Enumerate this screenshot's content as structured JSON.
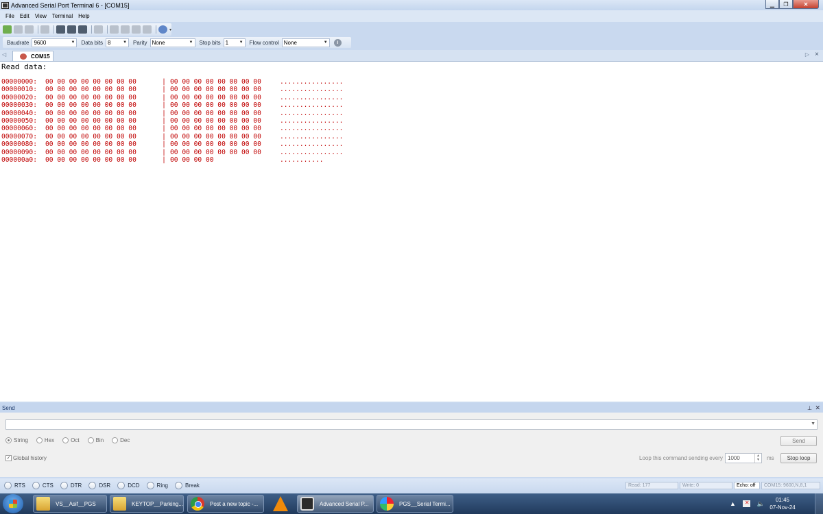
{
  "window": {
    "title": "Advanced Serial Port Terminal 6 - [COM15]"
  },
  "menu": [
    "File",
    "Edit",
    "View",
    "Terminal",
    "Help"
  ],
  "settings": {
    "baudrate_label": "Baudrate",
    "baudrate": "9600",
    "databits_label": "Data bits",
    "databits": "8",
    "parity_label": "Parity",
    "parity": "None",
    "stopbits_label": "Stop bits",
    "stopbits": "1",
    "flow_label": "Flow control",
    "flow": "None"
  },
  "tab": {
    "label": "COM15"
  },
  "terminal": {
    "header": "Read data:",
    "rows": [
      {
        "addr": "00000000:",
        "hex1": "00 00 00 00 00 00 00 00",
        "sep": "|",
        "hex2": "00 00 00 00 00 00 00 00",
        "ascii": "................"
      },
      {
        "addr": "00000010:",
        "hex1": "00 00 00 00 00 00 00 00",
        "sep": "|",
        "hex2": "00 00 00 00 00 00 00 00",
        "ascii": "................"
      },
      {
        "addr": "00000020:",
        "hex1": "00 00 00 00 00 00 00 00",
        "sep": "|",
        "hex2": "00 00 00 00 00 00 00 00",
        "ascii": "................"
      },
      {
        "addr": "00000030:",
        "hex1": "00 00 00 00 00 00 00 00",
        "sep": "|",
        "hex2": "00 00 00 00 00 00 00 00",
        "ascii": "................"
      },
      {
        "addr": "00000040:",
        "hex1": "00 00 00 00 00 00 00 00",
        "sep": "|",
        "hex2": "00 00 00 00 00 00 00 00",
        "ascii": "................"
      },
      {
        "addr": "00000050:",
        "hex1": "00 00 00 00 00 00 00 00",
        "sep": "|",
        "hex2": "00 00 00 00 00 00 00 00",
        "ascii": "................"
      },
      {
        "addr": "00000060:",
        "hex1": "00 00 00 00 00 00 00 00",
        "sep": "|",
        "hex2": "00 00 00 00 00 00 00 00",
        "ascii": "................"
      },
      {
        "addr": "00000070:",
        "hex1": "00 00 00 00 00 00 00 00",
        "sep": "|",
        "hex2": "00 00 00 00 00 00 00 00",
        "ascii": "................"
      },
      {
        "addr": "00000080:",
        "hex1": "00 00 00 00 00 00 00 00",
        "sep": "|",
        "hex2": "00 00 00 00 00 00 00 00",
        "ascii": "................"
      },
      {
        "addr": "00000090:",
        "hex1": "00 00 00 00 00 00 00 00",
        "sep": "|",
        "hex2": "00 00 00 00 00 00 00 00",
        "ascii": "................"
      },
      {
        "addr": "000000a0:",
        "hex1": "00 00 00 00 00 00 00 00",
        "sep": "|",
        "hex2": "00 00 00 00",
        "ascii": "..........."
      }
    ]
  },
  "send": {
    "title": "Send",
    "input_value": "",
    "formats": [
      "String",
      "Hex",
      "Oct",
      "Bin",
      "Dec"
    ],
    "selected_format": "String",
    "send_button": "Send",
    "history_label": "Global history",
    "loop_label": "Loop this command sending every",
    "loop_value": "1000",
    "loop_unit": "ms",
    "stop_loop_button": "Stop loop"
  },
  "signals": [
    "RTS",
    "CTS",
    "DTR",
    "DSR",
    "DCD",
    "Ring",
    "Break"
  ],
  "status": {
    "read": "Read: 177",
    "write": "Write: 0",
    "echo": "Echo: off",
    "port": "COM15: 9600,N,8,1"
  },
  "taskbar": {
    "items": [
      "VS__Asif__PGS",
      "KEYTOP__Parking...",
      "Post a new topic -...",
      "Advanced Serial P...",
      "PGS__Serial Termi..."
    ],
    "time": "01:45",
    "date": "07-Nov-24"
  },
  "colors": {
    "dump_text": "#c00000",
    "chrome_bg": "#c9d9ef",
    "taskbar": "#213a5c"
  }
}
